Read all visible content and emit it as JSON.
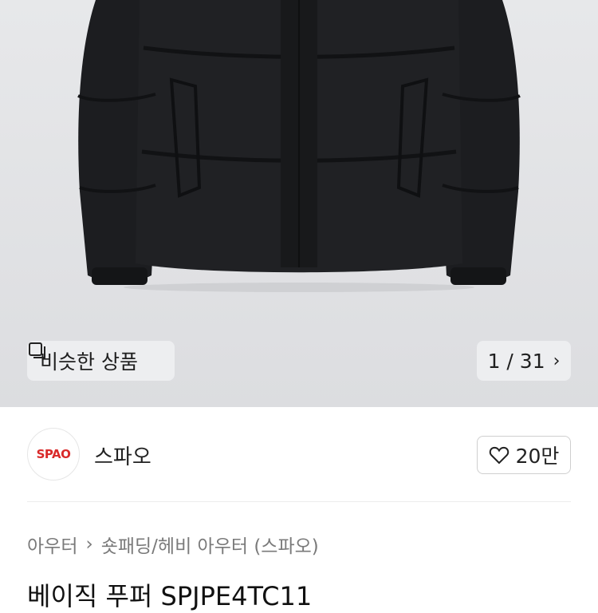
{
  "gallery": {
    "similar_label": "비슷한 상품",
    "similar_icon": "similar-items-icon",
    "pager_text": "1 / 31",
    "pager_icon": "chevron-right-icon"
  },
  "brand": {
    "logo_text": "SPAO",
    "name": "스파오",
    "likes": "20만",
    "like_icon": "heart-icon",
    "logo_color": "#d92a2a"
  },
  "breadcrumb": {
    "items": [
      "아우터",
      "숏패딩/헤비 아우터 (스파오)"
    ],
    "separator_icon": "chevron-right-icon"
  },
  "product": {
    "title": "베이직 푸퍼 SPJPE4TC11"
  }
}
